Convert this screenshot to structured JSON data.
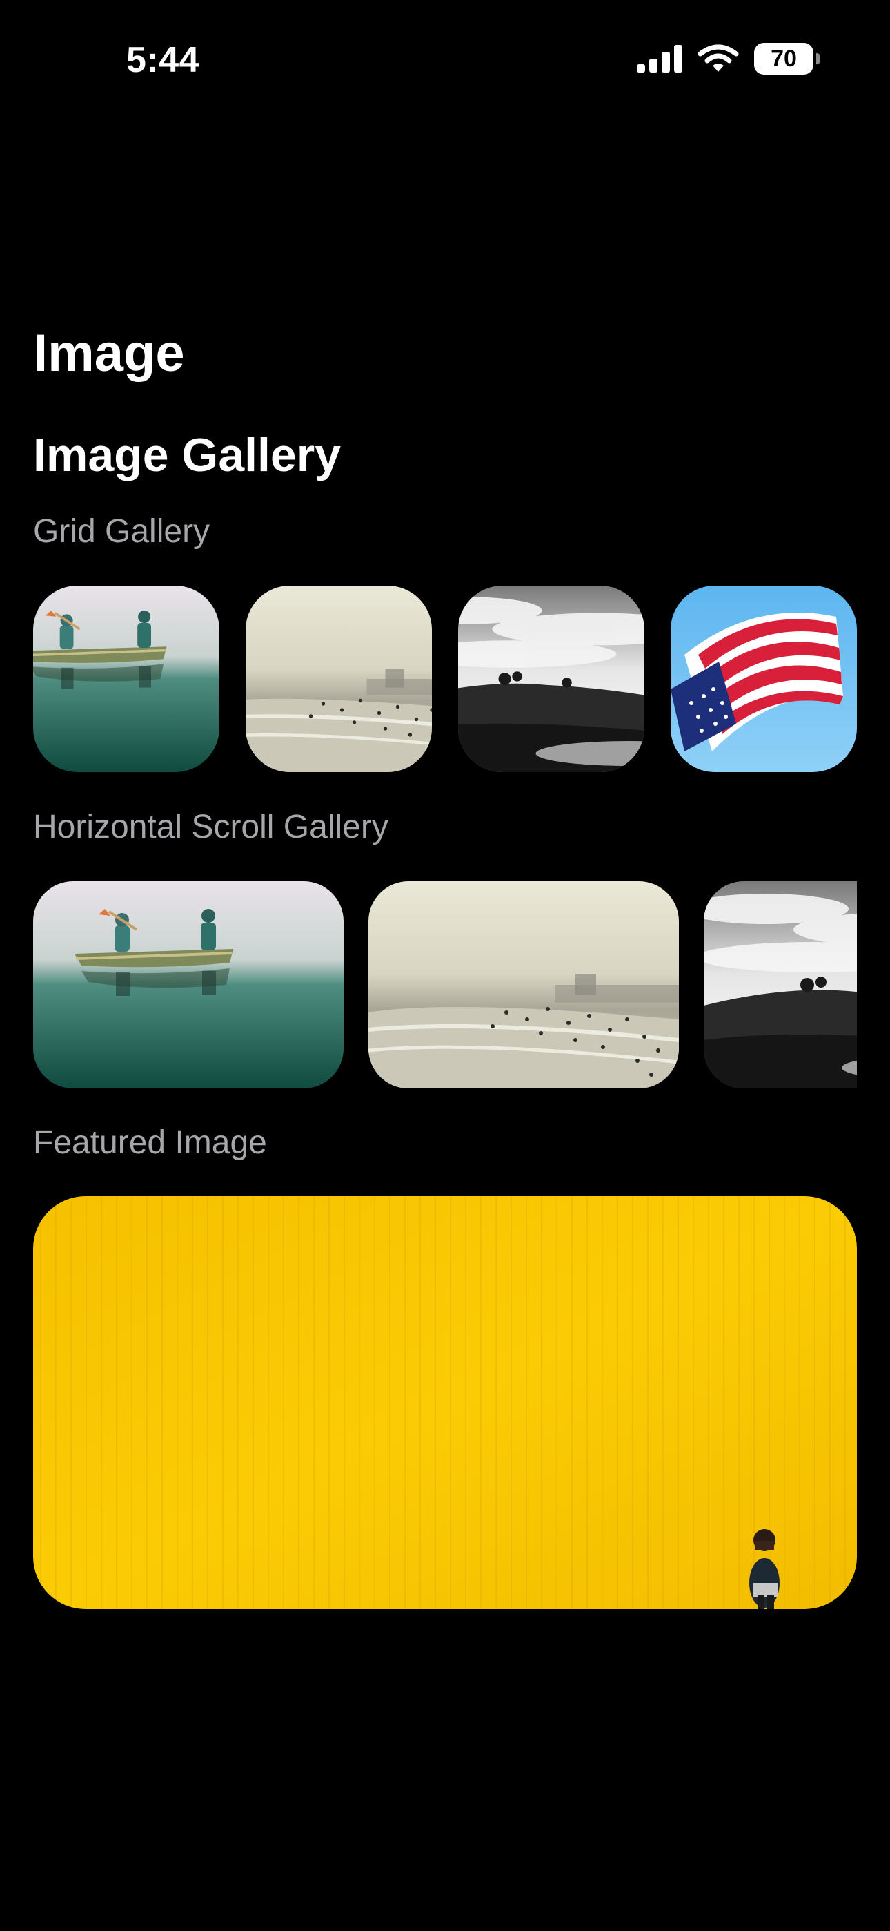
{
  "status_bar": {
    "time": "5:44",
    "battery_level": "70",
    "icons": [
      "signal-icon",
      "wifi-icon",
      "battery-icon"
    ]
  },
  "page": {
    "title": "Image",
    "section_title": "Image Gallery"
  },
  "grid_gallery": {
    "label": "Grid Gallery",
    "images": [
      "canoe-photo",
      "beach-photo",
      "clouds-photo",
      "flag-photo"
    ]
  },
  "horizontal_gallery": {
    "label": "Horizontal Scroll Gallery",
    "images": [
      "canoe-photo",
      "beach-photo",
      "clouds-photo"
    ]
  },
  "featured": {
    "label": "Featured Image",
    "image": "yellow-wall-photo"
  },
  "colors": {
    "background": "#000000",
    "label_gray": "#a7a7ab",
    "featured_yellow": "#f9c900"
  }
}
